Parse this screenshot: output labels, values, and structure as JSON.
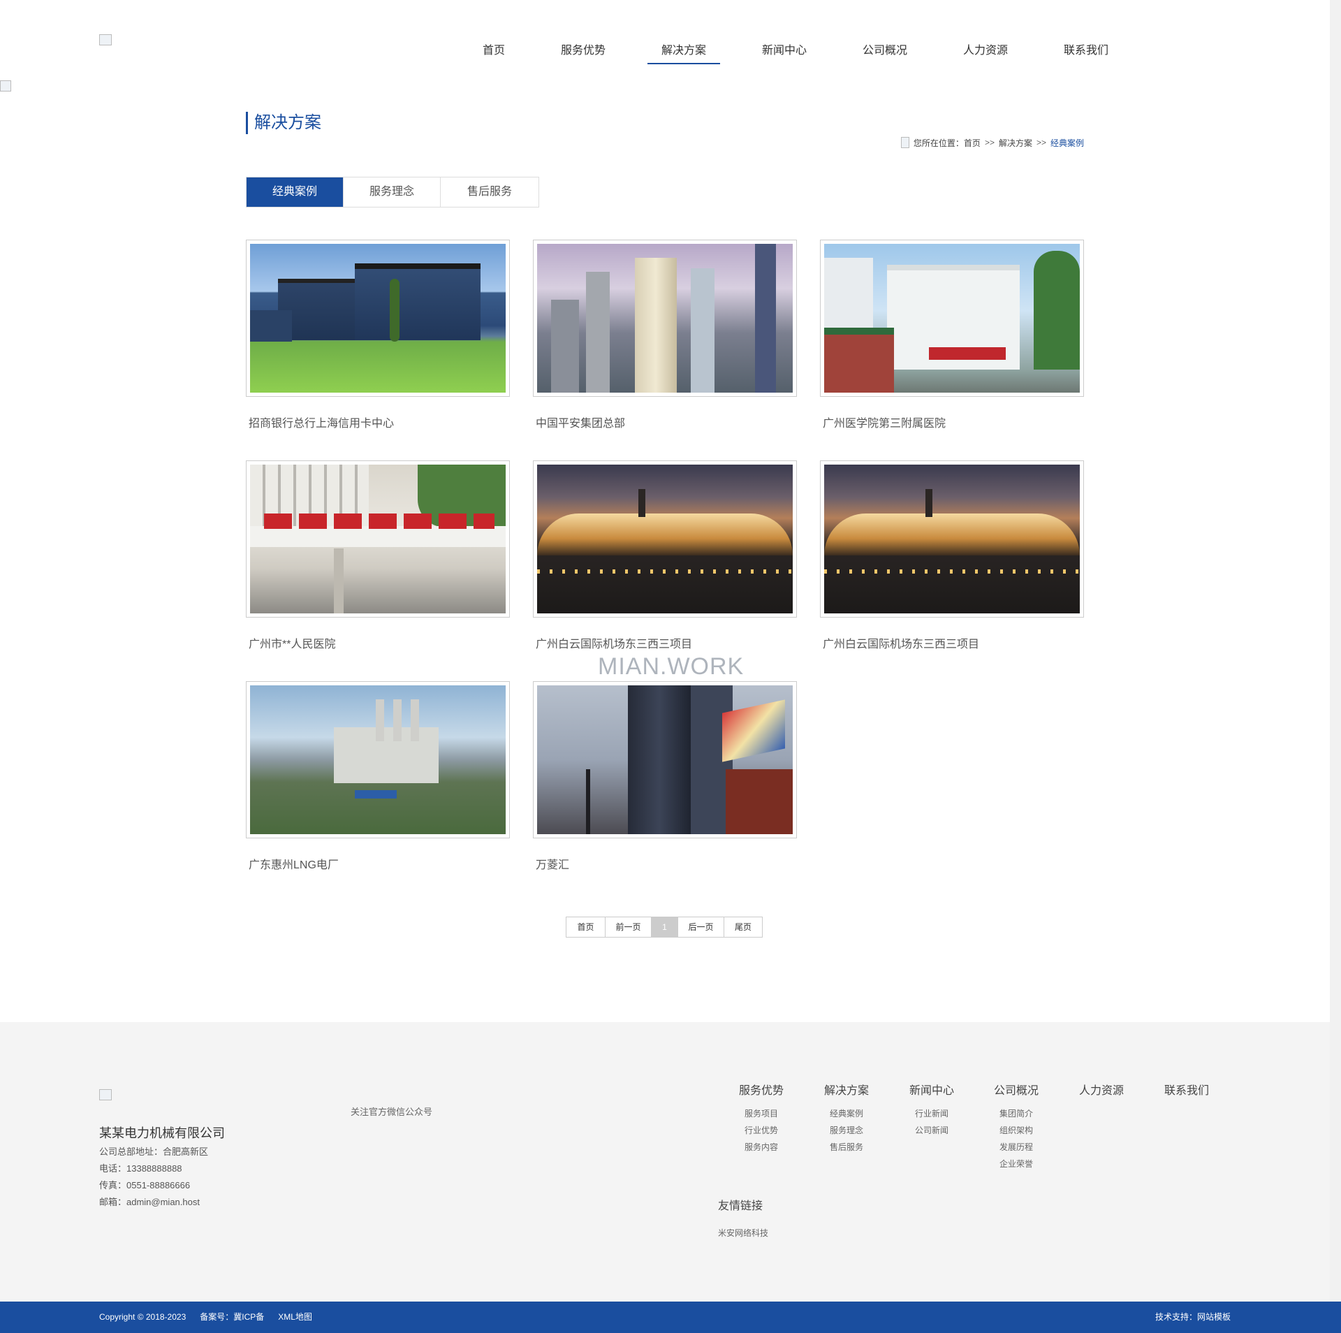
{
  "header": {
    "nav": [
      {
        "label": "首页",
        "active": false
      },
      {
        "label": "服务优势",
        "active": false
      },
      {
        "label": "解决方案",
        "active": true
      },
      {
        "label": "新闻中心",
        "active": false
      },
      {
        "label": "公司概况",
        "active": false
      },
      {
        "label": "人力资源",
        "active": false
      },
      {
        "label": "联系我们",
        "active": false
      }
    ]
  },
  "main": {
    "page_title": "解决方案",
    "breadcrumb": {
      "prefix": "您所在位置：",
      "items": [
        "首页",
        "解决方案",
        "经典案例"
      ],
      "separator": ">>"
    },
    "tabs": [
      {
        "label": "经典案例",
        "active": true
      },
      {
        "label": "服务理念",
        "active": false
      },
      {
        "label": "售后服务",
        "active": false
      }
    ],
    "cases": [
      {
        "title": "招商银行总行上海信用卡中心",
        "image": "modern-office-building-photo"
      },
      {
        "title": "中国平安集团总部",
        "image": "city-skyscrapers-photo"
      },
      {
        "title": "广州医学院第三附属医院",
        "image": "hospital-building-photo"
      },
      {
        "title": "广州市**人民医院",
        "image": "hospital-sign-photo"
      },
      {
        "title": "广州白云国际机场东三西三项目",
        "image": "airport-night-photo"
      },
      {
        "title": "广州白云国际机场东三西三项目",
        "image": "airport-night-photo"
      },
      {
        "title": "广东惠州LNG电厂",
        "image": "power-plant-photo"
      },
      {
        "title": "万菱汇",
        "image": "commercial-tower-photo"
      }
    ],
    "watermark": "MIAN.WORK",
    "pagination": {
      "first": "首页",
      "prev": "前一页",
      "current": "1",
      "next": "后一页",
      "last": "尾页"
    }
  },
  "footer": {
    "company_name": "某某电力机械有限公司",
    "address": "公司总部地址：合肥高新区",
    "phone": "电话：13388888888",
    "fax": "传真：0551-88886666",
    "email": "邮箱：admin@mian.host",
    "wechat_label": "关注官方微信公众号",
    "columns": [
      {
        "title": "服务优势",
        "items": [
          "服务项目",
          "行业优势",
          "服务内容"
        ]
      },
      {
        "title": "解决方案",
        "items": [
          "经典案例",
          "服务理念",
          "售后服务"
        ]
      },
      {
        "title": "新闻中心",
        "items": [
          "行业新闻",
          "公司新闻"
        ]
      },
      {
        "title": "公司概况",
        "items": [
          "集团简介",
          "组织架构",
          "发展历程",
          "企业荣誉"
        ]
      },
      {
        "title": "人力资源",
        "items": []
      },
      {
        "title": "联系我们",
        "items": []
      }
    ],
    "friend_links_title": "友情链接",
    "friend_links": [
      "米安网络科技"
    ],
    "copyright": "Copyright © 2018-2023",
    "icp": "备案号：冀ICP备",
    "sitemap": "XML地图",
    "tech_support_label": "技术支持：",
    "tech_support": "网站模板"
  },
  "colors": {
    "accent": "#1a4e9f",
    "footer_bg": "#f4f4f4"
  }
}
